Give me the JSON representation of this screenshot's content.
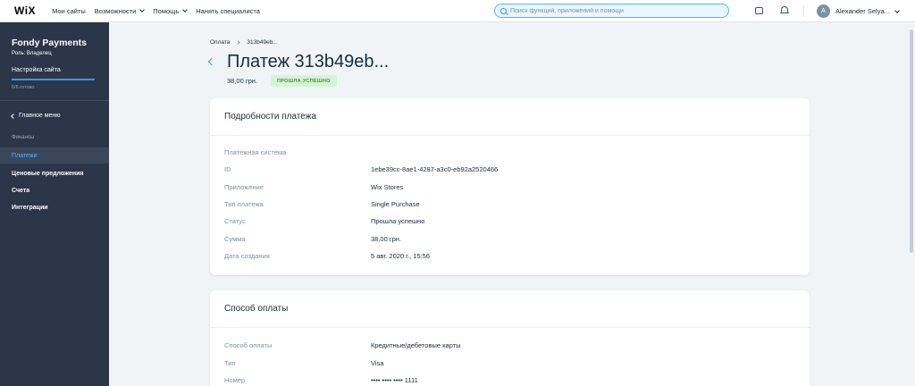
{
  "topbar": {
    "logo": "WiX",
    "nav": [
      {
        "label": "Мои сайты",
        "dropdown": false
      },
      {
        "label": "Возможности",
        "dropdown": true
      },
      {
        "label": "Помощь",
        "dropdown": true
      },
      {
        "label": "Нанять специалиста",
        "dropdown": false
      }
    ],
    "search_placeholder": "Поиск функций, приложений и помощи",
    "avatar_initial": "A",
    "username": "Alexander Selya..."
  },
  "sidebar": {
    "site_name": "Fondy Payments",
    "role": "Роль: Владелец",
    "setup_label": "Настройка сайта",
    "setup_progress": 1.0,
    "setup_progress_text": "6/6 готово",
    "main_menu": "Главное меню",
    "section_label": "Финансы",
    "items": [
      {
        "label": "Платежи",
        "active": true
      },
      {
        "label": "Ценовые предложения",
        "active": false
      },
      {
        "label": "Счета",
        "active": false
      },
      {
        "label": "Интеграции",
        "active": false
      }
    ]
  },
  "breadcrumb": [
    "Оплата",
    "313b49eb..."
  ],
  "page": {
    "title": "Платеж 313b49eb...",
    "amount": "38,00 грн.",
    "status_badge": "ПРОШЛА УСПЕШНО",
    "status_color": "#d4f5d4"
  },
  "details_card": {
    "title": "Подробности платежа",
    "rows": [
      {
        "label": "Платежная система",
        "value": ""
      },
      {
        "label": "ID",
        "value": "1ebe39cc-8ae1-4287-a3c0-eb92a2520466"
      },
      {
        "label": "Приложение",
        "value": "Wix Stores"
      },
      {
        "label": "Тип платежа",
        "value": "Single Purchase"
      },
      {
        "label": "Статус",
        "value": "Прошла успешно"
      },
      {
        "label": "Сумма",
        "value": "38,00 грн."
      },
      {
        "label": "Дата создания",
        "value": "5 авг. 2020 г., 15:56"
      }
    ]
  },
  "method_card": {
    "title": "Способ оплаты",
    "rows": [
      {
        "label": "Способ оплаты",
        "value": "Кредитные/дебетовые карты"
      },
      {
        "label": "Тип",
        "value": "Visa"
      },
      {
        "label": "Номер",
        "value": "•••• •••• •••• 1111"
      }
    ]
  }
}
